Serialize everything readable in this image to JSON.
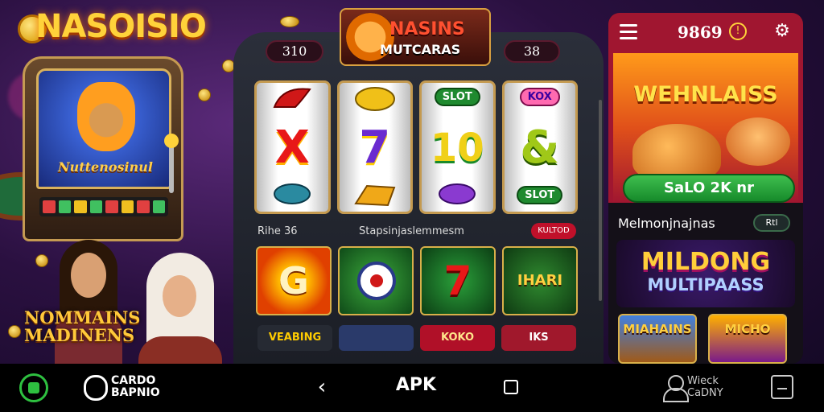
{
  "brand": {
    "logo_text": "NASOISIO"
  },
  "scene": {
    "machine_title": "Nuttenosinul",
    "ladies_title_line1": "NOMMAINS",
    "ladies_title_line2": "MADINENS"
  },
  "slot": {
    "game_logo_line1": "NASINS",
    "game_logo_line2": "MUTCARAS",
    "left_counter": "310",
    "right_counter": "38",
    "reels": [
      {
        "top": "",
        "mid": "X",
        "bot": ""
      },
      {
        "top": "",
        "mid": "7",
        "bot": ""
      },
      {
        "top": "SLOT",
        "mid": "10",
        "bot": ""
      },
      {
        "top": "KOX",
        "mid": "&",
        "bot": "SLOT"
      }
    ],
    "row_label_left": "Rihe 36",
    "row_label_center": "Stapsinjaslemmesm",
    "row_badge": "KULTOD",
    "tiles": [
      {
        "glyph": "G"
      },
      {
        "glyph": ""
      },
      {
        "glyph": "7"
      },
      {
        "glyph": "IHARI"
      }
    ],
    "bottom_tiles": [
      "VEABING",
      "",
      "KOKO",
      "IKS"
    ]
  },
  "phone": {
    "balance": "9869",
    "balance_icon": "!",
    "promo_title": "WEHNLAISS",
    "promo_button": "SaLO 2K nr",
    "section_title": "Melmonjnajnas",
    "section_pill": "Rtl",
    "banner_line1": "MILDONG",
    "banner_line2": "MULTIPAASS",
    "cards": [
      "MIAHAINS",
      "MICHO"
    ]
  },
  "navbar": {
    "brand_line1": "CARDO",
    "brand_line2": "BAPNIO",
    "back_glyph": "‹",
    "center_label": "APK",
    "user_line1": "Wieck",
    "user_line2": "CaDNY"
  },
  "colors": {
    "accent_red": "#a01630",
    "gold": "#ffd23a",
    "green": "#2ec040",
    "bg_purple": "#2a1040"
  }
}
